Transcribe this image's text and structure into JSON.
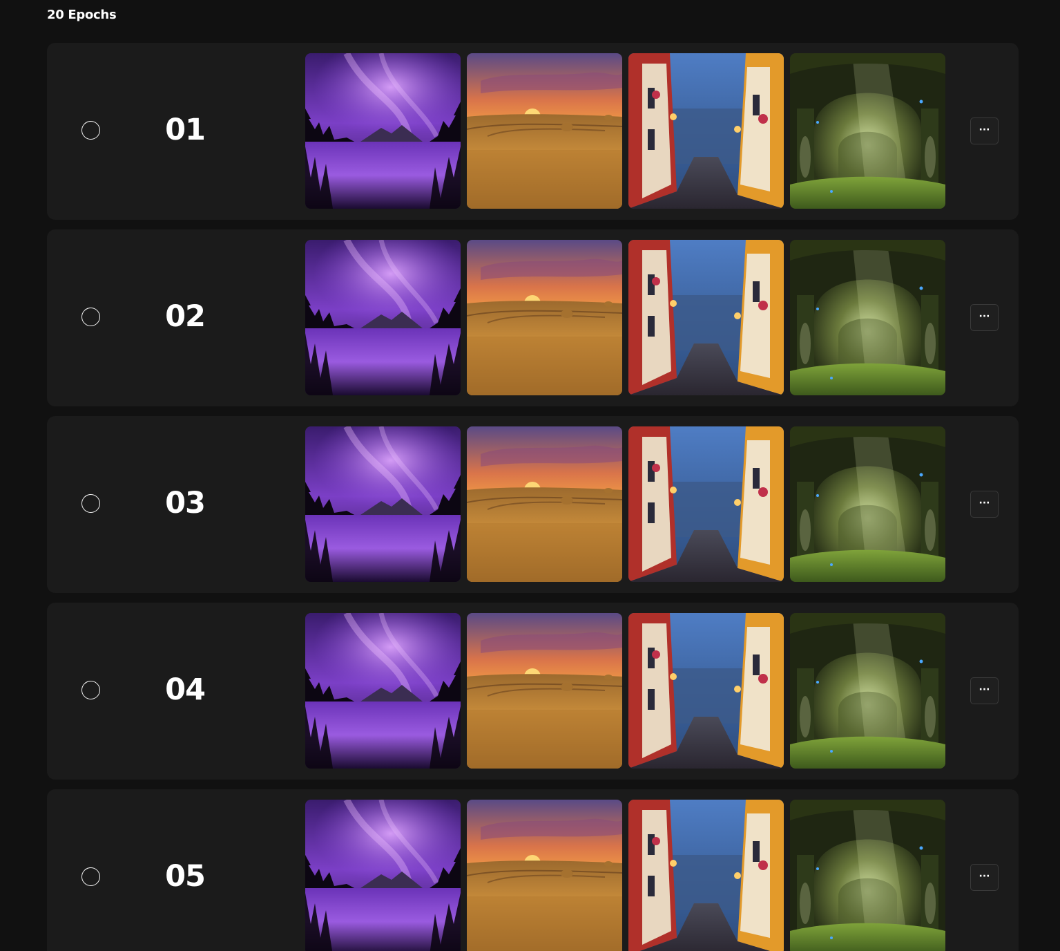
{
  "section": {
    "title": "20 Epochs"
  },
  "thumbnails": [
    {
      "icon": "aurora-lake-image"
    },
    {
      "icon": "sunset-wheat-field-image"
    },
    {
      "icon": "village-street-dusk-image"
    },
    {
      "icon": "mossy-garden-archway-image"
    }
  ],
  "epochs": [
    {
      "number": "01",
      "selected": false,
      "more_label": "···"
    },
    {
      "number": "02",
      "selected": false,
      "more_label": "···"
    },
    {
      "number": "03",
      "selected": false,
      "more_label": "···"
    },
    {
      "number": "04",
      "selected": false,
      "more_label": "···"
    },
    {
      "number": "05",
      "selected": false,
      "more_label": "···"
    }
  ],
  "colors": {
    "background": "#111111",
    "card": "#1b1b1b",
    "text": "#ffffff",
    "button_border": "#3a3a3a"
  }
}
